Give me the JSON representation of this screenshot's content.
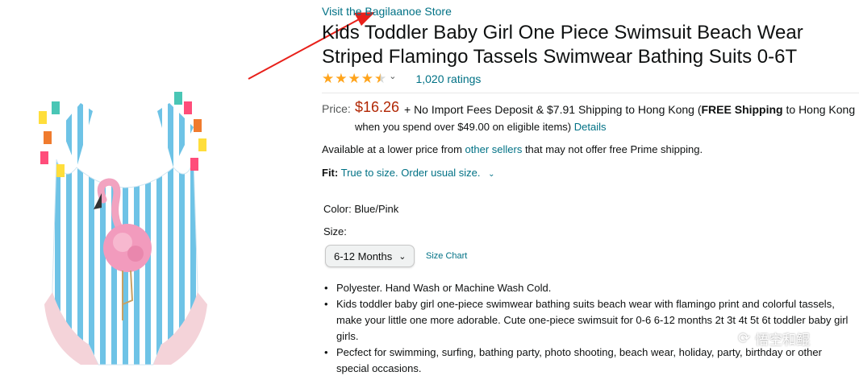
{
  "store_link": "Visit the Bagilaanoe Store",
  "title": "Kids Toddler Baby Girl One Piece Swimsuit Beach Wear Striped Flamingo Tassels Swimwear Bathing Suits 0-6T",
  "rating": {
    "value": 4.5,
    "count_label": "1,020 ratings"
  },
  "price": {
    "label": "Price:",
    "amount": "$16.26",
    "plus": "+ No Import Fees Deposit & $7.91 Shipping to Hong Kong (",
    "free_shipping": "FREE Shipping",
    "to_hk": " to Hong Kong",
    "line2": "when you spend over $49.00 on eligible items)",
    "details_link": "Details"
  },
  "availability": {
    "prefix": "Available at a lower price from ",
    "link": "other sellers",
    "suffix": " that may not offer free Prime shipping."
  },
  "fit": {
    "label": "Fit:",
    "value": "True to size. Order usual size."
  },
  "color": {
    "label": "Color:",
    "value": "Blue/Pink"
  },
  "size": {
    "label": "Size:",
    "selected": "6-12 Months",
    "chart_link": "Size Chart"
  },
  "bullets": [
    "Polyester. Hand Wash or Machine Wash Cold.",
    "Kids toddler baby girl one-piece swimwear bathing suits beach wear with flamingo print and colorful tassels, make your little one more adorable. Cute one-piece swimsuit for 0-6 6-12 months 2t 3t 4t 5t 6t toddler baby girl girls.",
    "Pecfect for swimming, surfing, bathing party, photo shooting, beach wear, holiday, party, birthday or other special occasions."
  ],
  "watermark": "悟空和鲲",
  "colors": {
    "link": "#007185",
    "price": "#b12704",
    "star": "#ffa41c",
    "arrow": "#e8201a"
  }
}
